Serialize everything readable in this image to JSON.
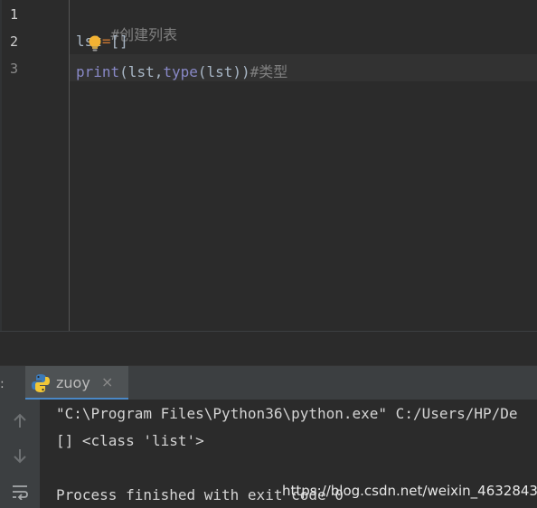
{
  "editor": {
    "line_numbers": [
      "1",
      "2",
      "3"
    ],
    "lines": [
      {
        "comment": "#创建列表"
      },
      {
        "var_a": "ls",
        "var_b": "t",
        "op": "=",
        "rest": "[]"
      },
      {
        "print": "print",
        "open": "(lst,",
        "type": "type",
        "mid": "(lst))",
        "comment": "#类型"
      }
    ]
  },
  "run": {
    "label": ":",
    "tab_title": "zuoy",
    "tab_close": "×",
    "console": [
      "\"C:\\Program Files\\Python36\\python.exe\" C:/Users/HP/De",
      "[] <class 'list'>",
      "",
      "Process finished with exit code 0"
    ]
  },
  "watermark": "https://blog.csdn.net/weixin_46328436",
  "colors": {
    "background": "#2b2b2b",
    "comment": "#808080",
    "keyword": "#8888c6",
    "operator": "#cc7832",
    "tab_underline": "#4a88c7"
  }
}
